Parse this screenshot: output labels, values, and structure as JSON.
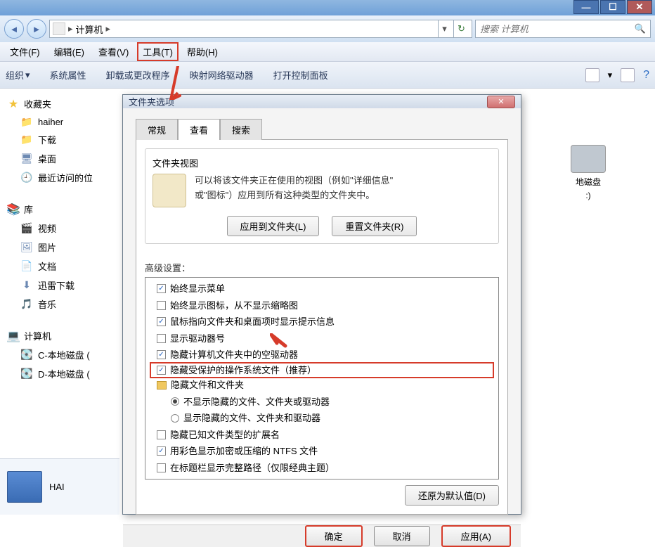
{
  "window_controls": {
    "min": "—",
    "max": "☐",
    "close": "✕"
  },
  "nav": {
    "back": "◄",
    "forward": "►",
    "path": "计算机",
    "sep": "▸",
    "dropdown": "▾",
    "refresh": "↻"
  },
  "search": {
    "placeholder": "搜索 计算机",
    "icon": "🔍"
  },
  "menu": {
    "file": "文件(F)",
    "edit": "编辑(E)",
    "view": "查看(V)",
    "tools": "工具(T)",
    "help": "帮助(H)"
  },
  "toolbar": {
    "organize": "组织",
    "sysprops": "系统属性",
    "uninstall": "卸载或更改程序",
    "mapnet": "映射网络驱动器",
    "ctrlpanel": "打开控制面板",
    "drop": "▾"
  },
  "sidebar": {
    "fav": {
      "header": "收藏夹",
      "items": [
        "haiher",
        "下载",
        "桌面",
        "最近访问的位"
      ]
    },
    "lib": {
      "header": "库",
      "items": [
        "视频",
        "图片",
        "文档",
        "迅雷下载",
        "音乐"
      ]
    },
    "comp": {
      "header": "计算机",
      "items": [
        "C-本地磁盘 (",
        "D-本地磁盘 ("
      ]
    }
  },
  "content": {
    "disk_label": "地磁盘",
    "disk_sub": ":)"
  },
  "details": {
    "label": "HAI"
  },
  "dialog": {
    "title": "文件夹选项",
    "close": "✕",
    "tabs": {
      "general": "常规",
      "view": "查看",
      "search": "搜索"
    },
    "folder_view": {
      "heading": "文件夹视图",
      "desc1": "可以将该文件夹正在使用的视图（例如\"详细信息\"",
      "desc2": "或\"图标\"）应用到所有这种类型的文件夹中。",
      "apply_btn": "应用到文件夹(L)",
      "reset_btn": "重置文件夹(R)"
    },
    "adv_label": "高级设置：",
    "adv_items": [
      {
        "type": "chk",
        "checked": true,
        "label": "始终显示菜单"
      },
      {
        "type": "chk",
        "checked": false,
        "label": "始终显示图标，从不显示缩略图"
      },
      {
        "type": "chk",
        "checked": true,
        "label": "鼠标指向文件夹和桌面项时显示提示信息"
      },
      {
        "type": "chk",
        "checked": false,
        "label": "显示驱动器号"
      },
      {
        "type": "chk",
        "checked": true,
        "label": "隐藏计算机文件夹中的空驱动器"
      },
      {
        "type": "chk",
        "checked": true,
        "label": "隐藏受保护的操作系统文件（推荐）",
        "highlighted": true
      },
      {
        "type": "folder",
        "label": "隐藏文件和文件夹"
      },
      {
        "type": "radio",
        "checked": true,
        "sub": true,
        "label": "不显示隐藏的文件、文件夹或驱动器"
      },
      {
        "type": "radio",
        "checked": false,
        "sub": true,
        "label": "显示隐藏的文件、文件夹和驱动器"
      },
      {
        "type": "chk",
        "checked": false,
        "label": "隐藏已知文件类型的扩展名"
      },
      {
        "type": "chk",
        "checked": true,
        "label": "用彩色显示加密或压缩的 NTFS 文件"
      },
      {
        "type": "chk",
        "checked": false,
        "label": "在标题栏显示完整路径（仅限经典主题）"
      }
    ],
    "restore_btn": "还原为默认值(D)",
    "footer": {
      "ok": "确定",
      "cancel": "取消",
      "apply": "应用(A)"
    }
  }
}
